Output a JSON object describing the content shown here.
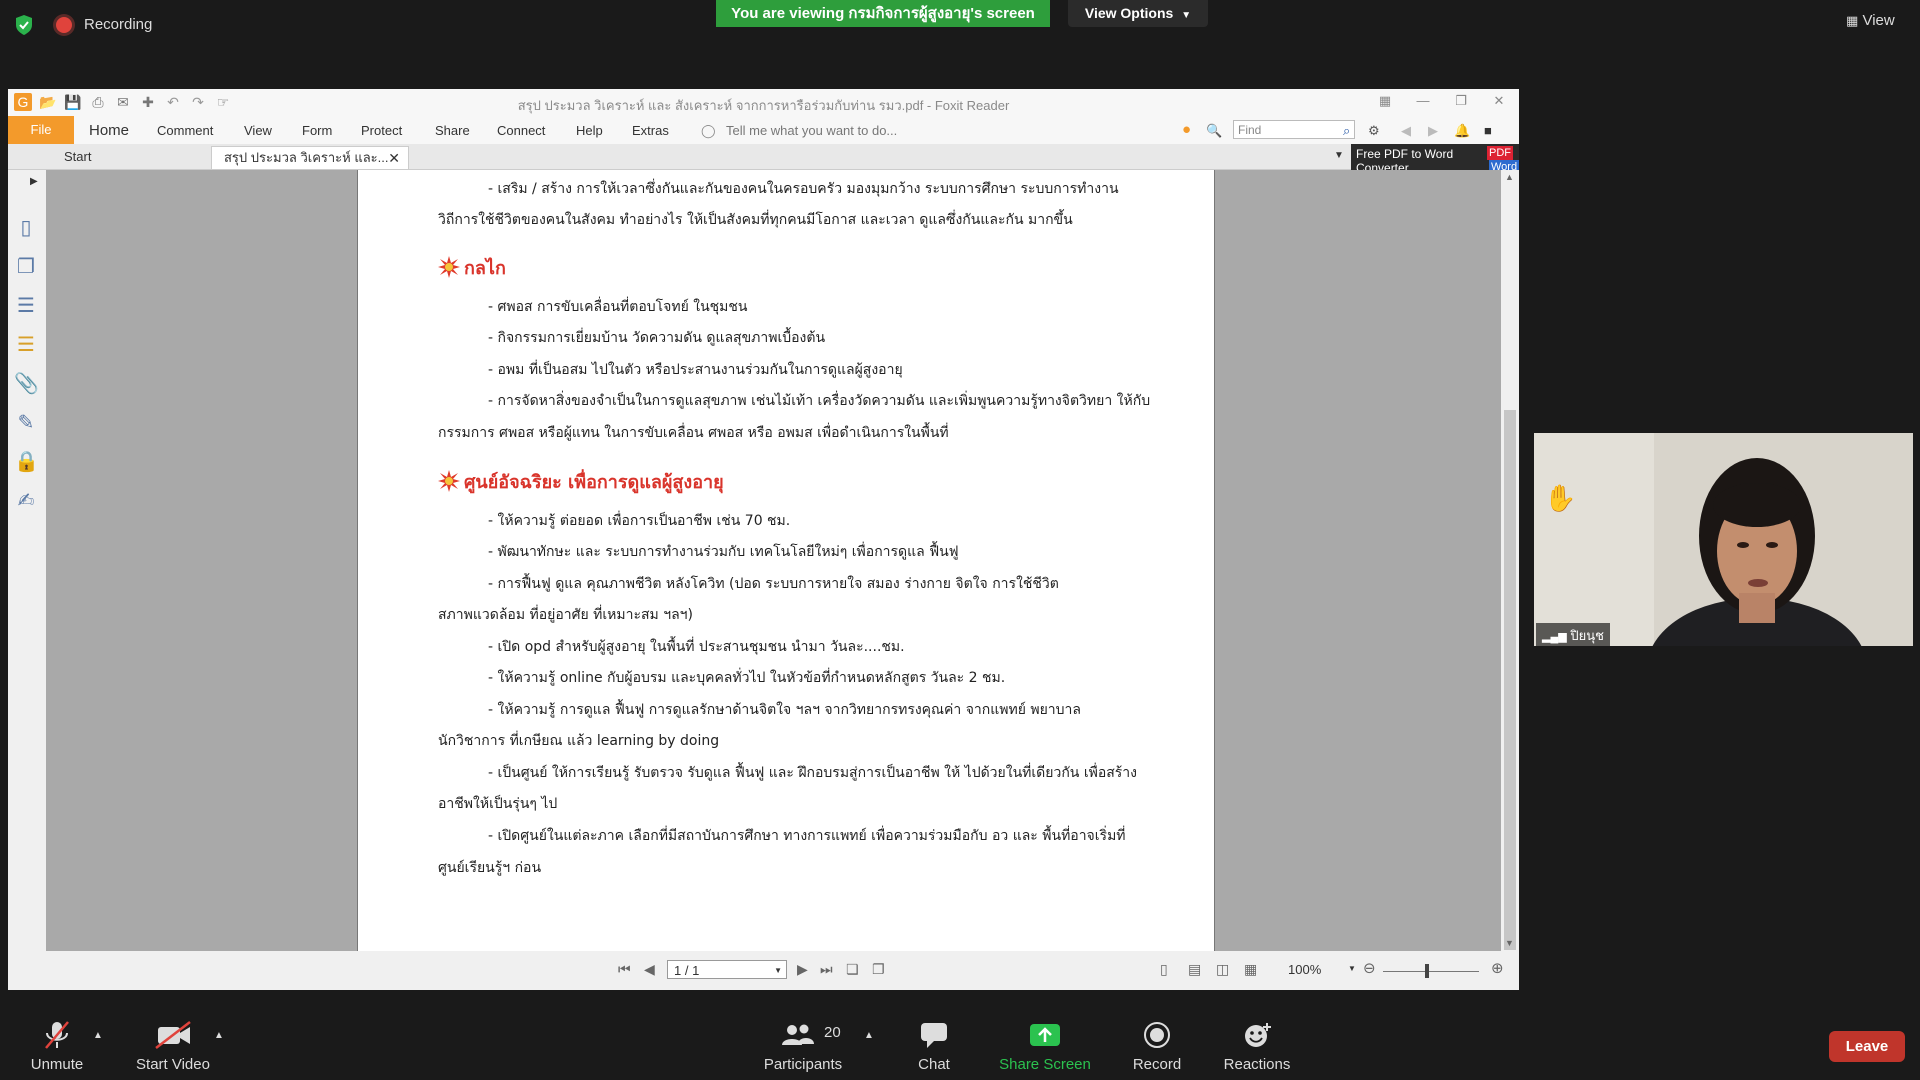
{
  "zoom": {
    "recording_label": "Recording",
    "viewing_banner": "You are viewing กรมกิจการผู้สูงอายุ's screen",
    "view_options_label": "View Options",
    "view_label": "View",
    "participant_name": "ปิยนุช",
    "toolbar": {
      "unmute": "Unmute",
      "start_video": "Start Video",
      "participants_count": "20",
      "participants": "Participants",
      "chat": "Chat",
      "share_screen": "Share Screen",
      "record": "Record",
      "reactions": "Reactions",
      "leave": "Leave"
    },
    "colors": {
      "banner_green": "#2e9e3c",
      "share_green": "#2bc24f",
      "leave_red": "#c0352b"
    }
  },
  "foxit": {
    "title": "สรุป ประมวล วิเคราะห์ และ สังเคราะห์ จากการหารือร่วมกับท่าน รมว.pdf - Foxit Reader",
    "menu": {
      "file": "File",
      "items": [
        "Home",
        "Comment",
        "View",
        "Form",
        "Protect",
        "Share",
        "Connect",
        "Help",
        "Extras"
      ],
      "tell_me": "Tell me what you want to do..."
    },
    "find_placeholder": "Find",
    "tabs": {
      "start": "Start",
      "doc": "สรุป ประมวล วิเคราะห์ และ..."
    },
    "promo": {
      "line1": "Free PDF to Word",
      "line2": "Converter",
      "badge_pdf": "PDF",
      "badge_word": "Word"
    },
    "status": {
      "page_field": "1 / 1",
      "zoom": "100%"
    }
  },
  "document": {
    "intro": [
      "- เสริม / สร้าง การให้เวลาซึ่งกันและกันของคนในครอบครัว มองมุมกว้าง ระบบการศึกษา ระบบการทำงาน",
      "วิถีการใช้ชีวิตของคนในสังคม ทำอย่างไร ให้เป็นสังคมที่ทุกคนมีโอกาส และเวลา ดูแลซึ่งกันและกัน มากขึ้น"
    ],
    "section1_title": "กลไก",
    "section1_lines": [
      "- ศพอส การขับเคลื่อนที่ตอบโจทย์ ในชุมชน",
      "- กิจกรรมการเยี่ยมบ้าน วัดความดัน ดูแลสุขภาพเบื้องต้น",
      "- อพม ที่เป็นอสม ไปในตัว หรือประสานงานร่วมกันในการดูแลผู้สูงอายุ",
      "- การจัดหาสิ่งของจำเป็นในการดูแลสุขภาพ เช่นไม้เท้า เครื่องวัดความดัน และเพิ่มพูนความรู้ทางจิตวิทยา ให้กับ",
      "กรรมการ ศพอส หรือผู้แทน ในการขับเคลื่อน ศพอส หรือ อพมส เพื่อดำเนินการในพื้นที่"
    ],
    "section2_title": "ศูนย์อัจฉริยะ เพื่อการดูแลผู้สูงอายุ",
    "section2_lines": [
      "- ให้ความรู้ ต่อยอด เพื่อการเป็นอาชีพ เช่น 70 ชม.",
      "- พัฒนาทักษะ และ ระบบการทำงานร่วมกับ เทคโนโลยีใหม่ๆ เพื่อการดูแล ฟื้นฟู",
      "- การฟื้นฟู ดูแล คุณภาพชีวิต หลังโควิท (ปอด ระบบการหายใจ สมอง ร่างกาย จิตใจ การใช้ชีวิต",
      "สภาพแวดล้อม ที่อยู่อาศัย ที่เหมาะสม ฯลฯ)",
      "- เปิด opd สำหรับผู้สูงอายุ ในพื้นที่ ประสานชุมชน นำมา วันละ....ชม.",
      "- ให้ความรู้ online กับผู้อบรม และบุคคลทั่วไป ในหัวข้อที่กำหนดหลักสูตร วันละ 2 ชม.",
      "- ให้ความรู้ การดูแล ฟื้นฟู การดูแลรักษาด้านจิตใจ ฯลฯ จากวิทยากรทรงคุณค่า จากแพทย์ พยาบาล",
      "นักวิชาการ ที่เกษียณ แล้ว learning by doing",
      "- เป็นศูนย์ ให้การเรียนรู้ รับตรวจ รับดูแล ฟื้นฟู และ ฝึกอบรมสู่การเป็นอาชีพ ให้ ไปด้วยในที่เดียวกัน เพื่อสร้าง",
      "อาชีพให้เป็นรุ่นๆ ไป",
      "- เปิดศูนย์ในแต่ละภาค เลือกที่มีสถาบันการศึกษา ทางการแพทย์ เพื่อความร่วมมือกับ อว และ พื้นที่อาจเริ่มที่",
      "ศูนย์เรียนรู้ฯ ก่อน"
    ],
    "colors": {
      "heading_red": "#d9342b"
    }
  }
}
